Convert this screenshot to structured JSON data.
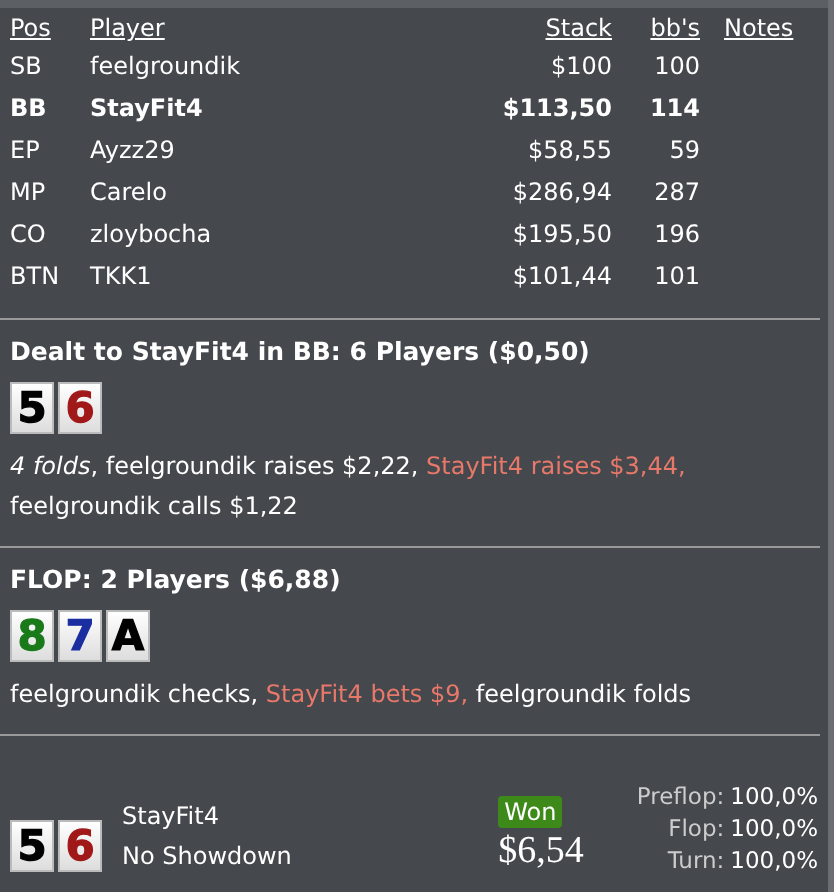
{
  "table": {
    "columns": [
      "Pos",
      "Player",
      "Stack",
      "bb's",
      "Notes"
    ],
    "rows": [
      {
        "pos": "SB",
        "player": "feelgroundik",
        "stack": "$100",
        "bbs": "100",
        "hero": false
      },
      {
        "pos": "BB",
        "player": "StayFit4",
        "stack": "$113,50",
        "bbs": "114",
        "hero": true
      },
      {
        "pos": "EP",
        "player": "Ayzz29",
        "stack": "$58,55",
        "bbs": "59",
        "hero": false
      },
      {
        "pos": "MP",
        "player": "Carelo",
        "stack": "$286,94",
        "bbs": "287",
        "hero": false
      },
      {
        "pos": "CO",
        "player": "zloybocha",
        "stack": "$195,50",
        "bbs": "196",
        "hero": false
      },
      {
        "pos": "BTN",
        "player": "TKK1",
        "stack": "$101,44",
        "bbs": "101",
        "hero": false
      }
    ]
  },
  "streets": [
    {
      "title": "Dealt to StayFit4 in BB: 6 Players ($0,50)",
      "cards": [
        {
          "rank": "5",
          "color": "#000000"
        },
        {
          "rank": "6",
          "color": "#a01818"
        }
      ],
      "actions": [
        {
          "text": "4 folds",
          "kind": "fold"
        },
        {
          "text": ", feelgroundik raises $2,22, ",
          "kind": "normal"
        },
        {
          "text": "StayFit4 raises $3,44, ",
          "kind": "hero"
        },
        {
          "text": "feelgroundik calls $1,22",
          "kind": "normal"
        }
      ]
    },
    {
      "title": "FLOP: 2 Players ($6,88)",
      "cards": [
        {
          "rank": "8",
          "color": "#1a7a1a"
        },
        {
          "rank": "7",
          "color": "#1a2ea0"
        },
        {
          "rank": "A",
          "color": "#000000"
        }
      ],
      "actions": [
        {
          "text": "feelgroundik checks, ",
          "kind": "normal"
        },
        {
          "text": "StayFit4 bets $9, ",
          "kind": "hero"
        },
        {
          "text": "feelgroundik folds",
          "kind": "normal"
        }
      ]
    }
  ],
  "summary": {
    "cards": [
      {
        "rank": "5",
        "color": "#000000"
      },
      {
        "rank": "6",
        "color": "#a01818"
      }
    ],
    "player": "StayFit4",
    "result": "No Showdown",
    "badge": "Won",
    "amount": "$6,54",
    "equity": [
      {
        "label": "Preflop:",
        "value": "100,0%"
      },
      {
        "label": "Flop:",
        "value": "100,0%"
      },
      {
        "label": "Turn:",
        "value": "100,0%"
      }
    ]
  }
}
